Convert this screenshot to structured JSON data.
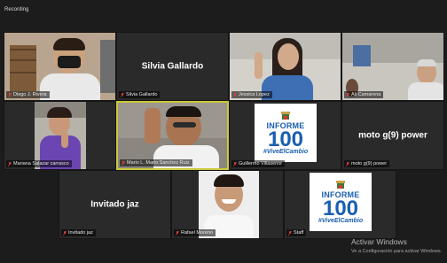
{
  "recording": "Recording",
  "participants": [
    {
      "name": "Diego J. Rivera",
      "tile": "video"
    },
    {
      "name": "Silvia Gallardo",
      "tile": "name-only"
    },
    {
      "name": "Jessica Lopez",
      "tile": "video"
    },
    {
      "name": "Ali Camarena",
      "tile": "video"
    },
    {
      "name": "Mariana Salazar carrasco",
      "tile": "video"
    },
    {
      "name": "Mario L. Mario Sanchez Ruiz",
      "tile": "video",
      "active_speaker": true
    },
    {
      "name": "Guillermo Villasenor",
      "tile": "logo"
    },
    {
      "name": "moto g(9) power",
      "tile": "name-only"
    },
    {
      "name": "Invitado jaz",
      "tile": "name-only"
    },
    {
      "name": "Rafael Moreno",
      "tile": "video"
    },
    {
      "name": "Staff",
      "tile": "logo"
    }
  ],
  "logo": {
    "line1": "INFORME",
    "line2": "100",
    "line3": "#ViveElCambio"
  },
  "watermark": {
    "title": "Activar Windows",
    "subtitle": "Ve a Configuración para activar Windows."
  },
  "colors": {
    "active_border": "#c9c93a",
    "logo_blue": "#1a5fb0",
    "mic_muted": "#e0413a"
  }
}
